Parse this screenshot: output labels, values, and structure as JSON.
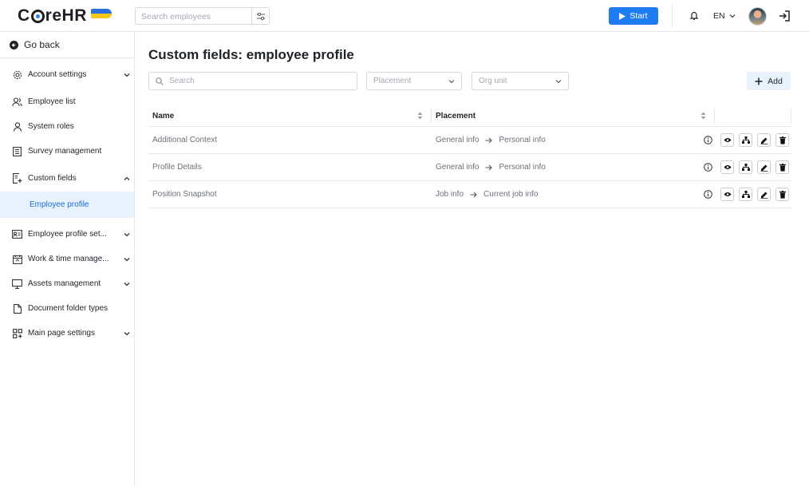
{
  "header": {
    "logo_text_pre": "C",
    "logo_text_post": "reHR",
    "search_placeholder": "Search employees",
    "start_label": "Start",
    "lang": "EN"
  },
  "sidebar": {
    "go_back": "Go back",
    "items": [
      {
        "label": "Account settings",
        "icon": "gear-icon",
        "expand": "down"
      },
      {
        "label": "Employee list",
        "icon": "users-icon",
        "expand": ""
      },
      {
        "label": "System roles",
        "icon": "user-icon",
        "expand": ""
      },
      {
        "label": "Survey management",
        "icon": "survey-icon",
        "expand": ""
      },
      {
        "label": "Custom fields",
        "icon": "custom-fields-icon",
        "expand": "up"
      },
      {
        "label": "Employee profile set...",
        "icon": "id-card-icon",
        "expand": "down"
      },
      {
        "label": "Work & time manage...",
        "icon": "calendar-icon",
        "expand": "down"
      },
      {
        "label": "Assets management",
        "icon": "monitor-icon",
        "expand": "down"
      },
      {
        "label": "Document folder types",
        "icon": "document-icon",
        "expand": ""
      },
      {
        "label": "Main page settings",
        "icon": "grid-icon",
        "expand": "down"
      }
    ],
    "sub_item": "Employee profile"
  },
  "main": {
    "title": "Custom fields: employee profile",
    "search_placeholder": "Search",
    "placement_placeholder": "Placement",
    "org_unit_placeholder": "Org unit",
    "add_label": "Add",
    "columns": [
      "Name",
      "Placement"
    ],
    "rows": [
      {
        "name": "Additional Context",
        "from": "General info",
        "to": "Personal info"
      },
      {
        "name": "Profile Details",
        "from": "General info",
        "to": "Personal info"
      },
      {
        "name": "Position Snapshot",
        "from": "Job info",
        "to": "Current job info"
      }
    ]
  },
  "colors": {
    "accent": "#1f7bf2",
    "active_bg": "#e8f2fc",
    "active_text": "#1a6fd8"
  }
}
